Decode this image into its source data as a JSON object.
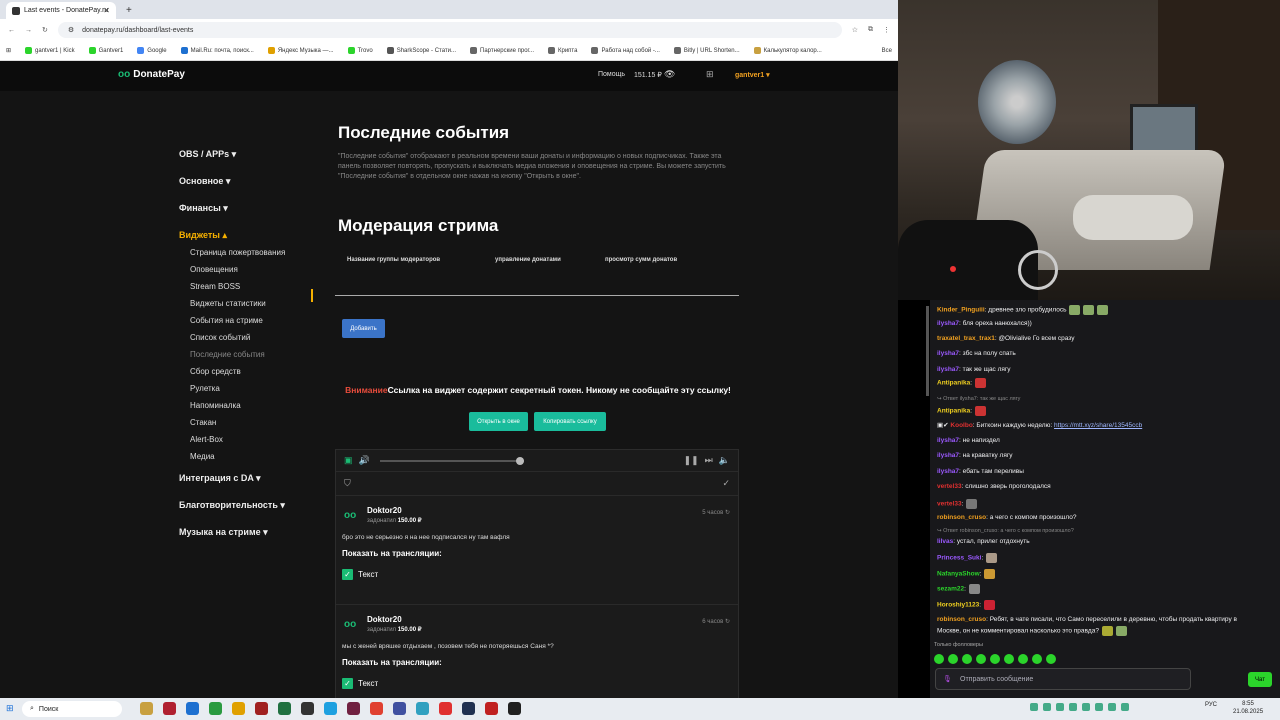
{
  "browser": {
    "tab_title": "Last events - DonatePay.ru",
    "url": "donatepay.ru/dashboard/last-events",
    "bookmarks": [
      "gantver1 | Kick",
      "Gantver1",
      "Google",
      "Mail.Ru: почта, поиск...",
      "Яндекс Музыка —...",
      "Trovo",
      "SharkScope - Стати...",
      "Партнерские прог...",
      "Крипта",
      "Работа над собой -...",
      "Bitly | URL Shorten...",
      "Калькулятор калор..."
    ],
    "bookmarks_all": "Все"
  },
  "site": {
    "logo": "DonatePay",
    "help": "Помощь",
    "balance": "151.15 ₽",
    "user": "gantver1 ▾",
    "sidebar": [
      {
        "label": "OBS / APPs ▾"
      },
      {
        "label": "Основное ▾"
      },
      {
        "label": "Финансы ▾"
      },
      {
        "label": "Виджеты ▴"
      }
    ],
    "sidebar_sub": [
      "Страница пожертвования",
      "Оповещения",
      "Stream BOSS",
      "Виджеты статистики",
      "События на стриме",
      "Список событий",
      "Последние события",
      "Сбор средств",
      "Рулетка",
      "Напоминалка",
      "Стакан",
      "Alert-Box",
      "Медиа"
    ],
    "sidebar_bottom": [
      "Интеграция с DA ▾",
      "Благотворительность ▾",
      "Музыка на стриме ▾"
    ],
    "title": "Последние события",
    "description": "\"Последние события\" отображают в реальном времени ваши донаты и информацию о новых подписчиках. Также эта панель позволяет повторять, пропускать и выключать медиа вложения и оповещения на стриме. Вы можете запустить \"Последние события\" в отдельном окне нажав на кнопку \"Открыть в окне\".",
    "mod_title": "Модерация стрима",
    "mod_cols": [
      "Название группы модераторов",
      "управление донатами",
      "просмотр сумм донатов"
    ],
    "add_btn": "Добавить",
    "warn_red": "Внимание",
    "warn_text": "Ссылка на виджет содержит секретный токен. Никому не сообщайте эту ссылку!",
    "open_btn": "Открыть в окне",
    "copy_btn": "Копировать ссылку",
    "events": [
      {
        "name": "Doktor20",
        "donated": "задонатил",
        "amount": "150.00 ₽",
        "time": "5 часов",
        "message": "бро это не серьезно я на нее подписался ну там вафля",
        "show": "Показать на трансляции:",
        "check": "Текст"
      },
      {
        "name": "Doktor20",
        "donated": "задонатил",
        "amount": "150.00 ₽",
        "time": "6 часов",
        "message": "мы с женей вряшке отдыхаем , позовем тебя не потеряешься Саня *?",
        "show": "Показать на трансляции:",
        "check": "Текст"
      }
    ]
  },
  "chat": {
    "messages": [
      {
        "user": "Kinder_Pinguiii",
        "color": "#f0a020",
        "text": ": древнее зло пробудилось"
      },
      {
        "user": "ilysha7",
        "color": "#9b59ff",
        "text": ": бля ореха нанюхался))"
      },
      {
        "user": "traxatel_trax_trax1",
        "color": "#f0a020",
        "text": ": @Olivialive Го всем сразу"
      },
      {
        "user": "ilysha7",
        "color": "#9b59ff",
        "text": ": збс на полу спать"
      },
      {
        "user": "ilysha7",
        "color": "#9b59ff",
        "text": ": так же щас лягу"
      },
      {
        "user": "Antipanika",
        "color": "#f0d020",
        "text": ":"
      },
      {
        "user": "Antipanika",
        "color": "#f0d020",
        "text": ":"
      },
      {
        "user": "Koolbo",
        "color": "#e03030",
        "text": ": Биткоин каждую неделю: "
      },
      {
        "user": "ilysha7",
        "color": "#9b59ff",
        "text": ": не напиздел"
      },
      {
        "user": "ilysha7",
        "color": "#9b59ff",
        "text": ": на краватку лягу"
      },
      {
        "user": "ilysha7",
        "color": "#9b59ff",
        "text": ": ебать там переливы"
      },
      {
        "user": "vertel33",
        "color": "#e03030",
        "text": ": слишно зверь проголодался"
      },
      {
        "user": "vertel33",
        "color": "#e03030",
        "text": ":"
      },
      {
        "user": "robinson_cruso",
        "color": "#f0a020",
        "text": ": а чего с компом произошло?"
      },
      {
        "user": "lilvas",
        "color": "#9b59ff",
        "text": ": устал, прилег отдохнуть"
      },
      {
        "user": "Princess_Suki",
        "color": "#9b59ff",
        "text": ":"
      },
      {
        "user": "NafanyaShow",
        "color": "#2bd42b",
        "text": ":"
      },
      {
        "user": "sezam22",
        "color": "#2bd42b",
        "text": ":"
      },
      {
        "user": "Horoshiy1123",
        "color": "#f0d020",
        "text": ":"
      },
      {
        "user": "robinson_cruso",
        "color": "#f0a020",
        "text": ": Ребят, в чате писали, что Само переселили в деревню, чтобы продать квартиру в"
      },
      {
        "user": "",
        "color": "#efeff1",
        "text": "Москве, он не комментировал насколько это правда?"
      }
    ],
    "reply1": "Ответ ilysha7: так же щас лягу",
    "reply2": "Ответ robinson_cruso: а чего с компом произошло?",
    "link": "https://mtt.xyz/share/13545ccb",
    "followers": "Только фолловеры",
    "input_placeholder": "Отправить сообщение",
    "send": "Чат"
  },
  "taskbar": {
    "search": "Поиск",
    "lang": "РУС",
    "time": "8:55",
    "date": "21.08.2025"
  }
}
